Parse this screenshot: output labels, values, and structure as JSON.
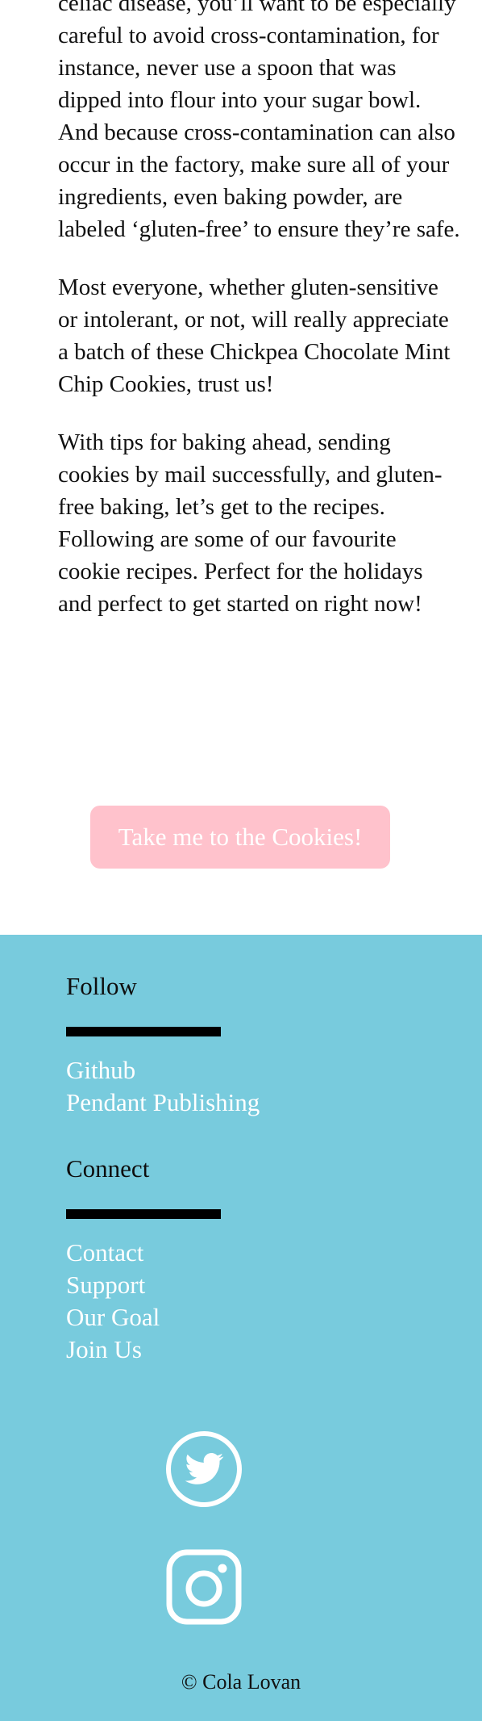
{
  "article": {
    "paragraphs": [
      "celiac disease, you’ll want to be especially careful to avoid cross-contamination, for instance, never use a spoon that was dipped into flour into your sugar bowl. And because cross-contamination can also occur in the factory, make sure all of your ingredients, even baking powder, are labeled ‘gluten-free’ to ensure they’re safe.",
      "Most everyone, whether gluten-sensitive or intolerant, or not, will really appreciate a batch of these Chickpea Chocolate Mint Chip Cookies, trust us!",
      "With tips for baking ahead, sending cookies by mail successfully, and gluten-free baking, let’s get to the recipes. Following are some of our favourite cookie recipes. Perfect for the holidays and perfect to get started on right now!"
    ]
  },
  "cta": {
    "label": "Take me to the Cookies!"
  },
  "footer": {
    "follow": {
      "heading": "Follow",
      "links": [
        "Github",
        "Pendant Publishing"
      ]
    },
    "connect": {
      "heading": "Connect",
      "links": [
        "Contact",
        "Support",
        "Our Goal",
        "Join Us"
      ]
    },
    "social": [
      "twitter-icon",
      "instagram-icon"
    ],
    "copyright": "© Cola Lovan"
  },
  "colors": {
    "footer_bg": "#78cbdd",
    "button_bg": "#ffc2cc",
    "link": "#ffffff",
    "heading_bar": "#000000"
  }
}
